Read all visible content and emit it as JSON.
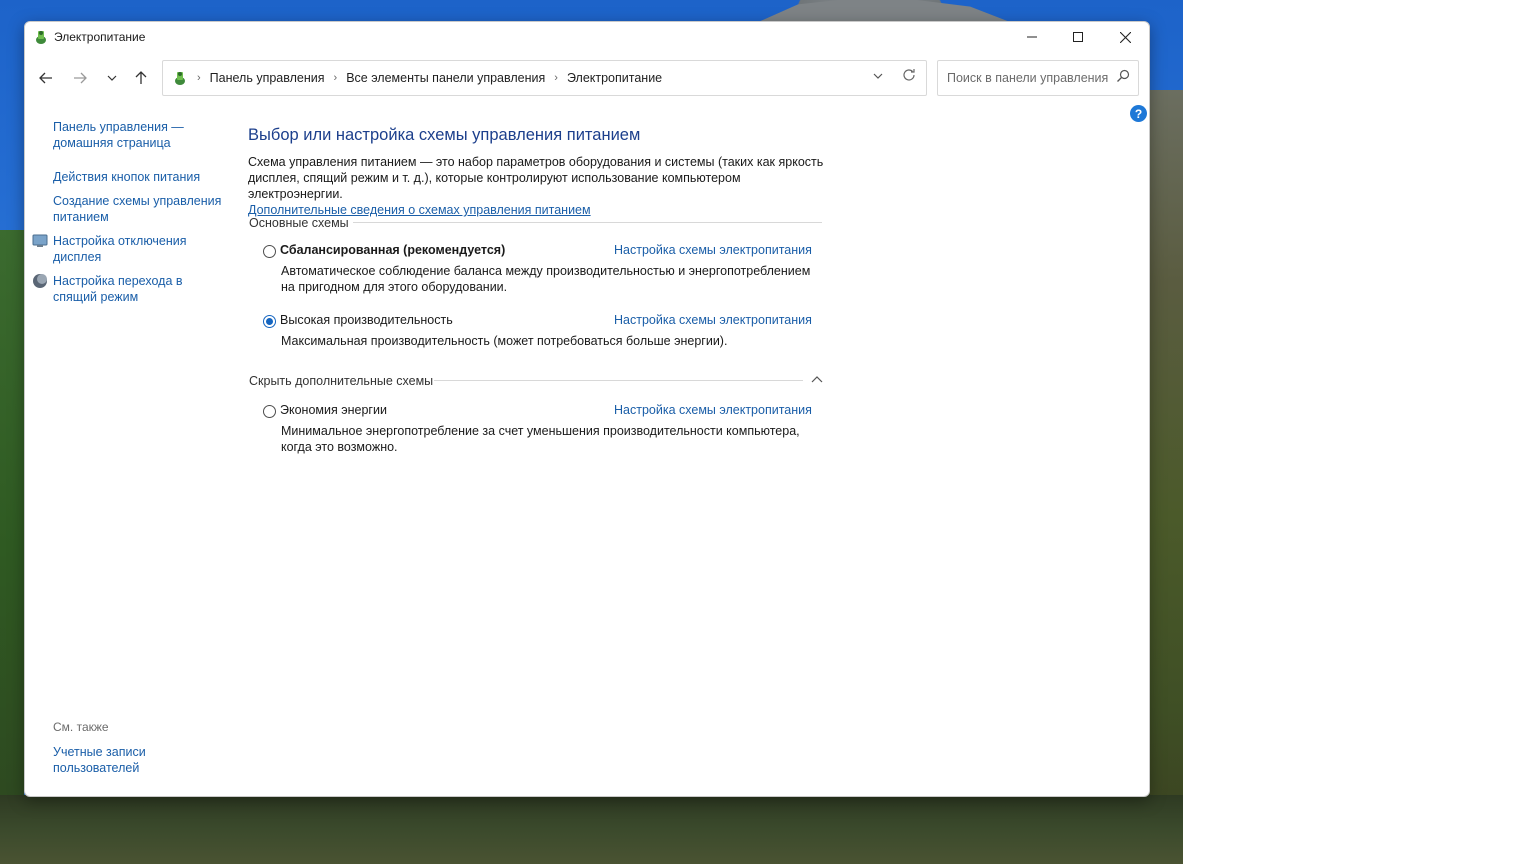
{
  "window": {
    "title": "Электропитание",
    "controls": {
      "minimize": "—",
      "maximize": "☐",
      "close": "✕"
    }
  },
  "nav": {
    "back_icon": "arrow-left-icon",
    "forward_icon": "arrow-right-icon",
    "recent_icon": "chevron-down-icon",
    "up_icon": "arrow-up-icon",
    "breadcrumb": [
      "Панель управления",
      "Все элементы панели управления",
      "Электропитание"
    ],
    "search_placeholder": "Поиск в панели управления"
  },
  "sidebar": {
    "items": [
      {
        "label_line1": "Панель управления —",
        "label_line2": "домашняя страница"
      },
      {
        "label_line1": "Действия кнопок питания"
      },
      {
        "label_line1": "Создание схемы управления",
        "label_line2": "питанием"
      },
      {
        "label_line1": "Настройка отключения",
        "label_line2": "дисплея",
        "icon": "monitor-icon"
      },
      {
        "label_line1": "Настройка перехода в",
        "label_line2": "спящий режим",
        "icon": "moon-icon"
      }
    ],
    "see_also": "См. также",
    "see_also_items": [
      {
        "label_line1": "Учетные записи",
        "label_line2": "пользователей"
      }
    ]
  },
  "main": {
    "title": "Выбор или настройка схемы управления питанием",
    "description_line1": "Схема управления питанием — это набор параметров оборудования и системы (таких как яркость",
    "description_line2": "дисплея, спящий режим и т. д.), которые контролируют использование компьютером электроэнергии.",
    "more_link": "Дополнительные сведения о схемах управления питанием",
    "group_basic": "Основные схемы",
    "group_hidden": "Скрыть дополнительные схемы",
    "plans": [
      {
        "name": "Сбалансированная (рекомендуется)",
        "link": "Настройка схемы электропитания",
        "desc_line1": "Автоматическое соблюдение баланса между производительностью и энергопотреблением",
        "desc_line2": "на пригодном для этого оборудовании.",
        "selected": false
      },
      {
        "name": "Высокая производительность",
        "link": "Настройка схемы электропитания",
        "desc_line1": "Максимальная производительность (может потребоваться больше энергии).",
        "selected": true
      },
      {
        "name": "Экономия энергии",
        "link": "Настройка схемы электропитания",
        "desc_line1": "Минимальное энергопотребление за счет уменьшения производительности компьютера,",
        "desc_line2": "когда это возможно.",
        "selected": false
      }
    ],
    "help": "?"
  },
  "colors": {
    "link": "#1a5ea8",
    "title": "#1c3f8c",
    "accent": "#1565c0"
  }
}
